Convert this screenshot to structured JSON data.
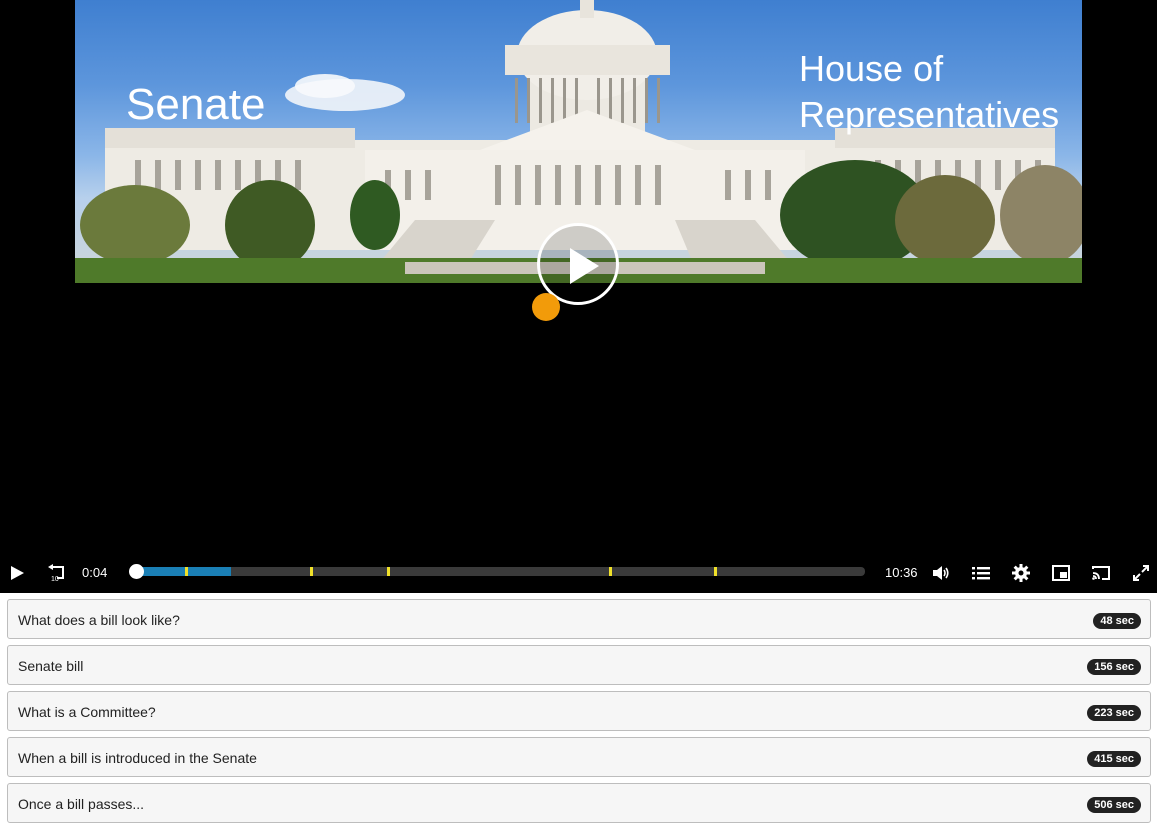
{
  "video": {
    "overlay_left": "Senate",
    "overlay_right": "House of\nRepresentatives"
  },
  "controls": {
    "current_time": "0:04",
    "duration": "10:36",
    "progress": 0.0063,
    "buffered": 0.136,
    "icons": [
      "play-icon",
      "rewind-10-icon",
      "volume-icon",
      "chapters-list-icon",
      "settings-gear-icon",
      "picture-in-picture-icon",
      "cast-icon",
      "fullscreen-icon"
    ]
  },
  "chapters": [
    {
      "title": "What does a bill look like?",
      "badge": "48 sec"
    },
    {
      "title": "Senate bill",
      "badge": "156 sec"
    },
    {
      "title": "What is a Committee?",
      "badge": "223 sec"
    },
    {
      "title": "When a bill is introduced in the Senate",
      "badge": "415 sec"
    },
    {
      "title": "Once a bill passes...",
      "badge": "506 sec"
    }
  ],
  "colors": {
    "accent": "#1a7fb5",
    "chapter_marker": "#f0e12a",
    "hotspot": "#f29b0a"
  }
}
